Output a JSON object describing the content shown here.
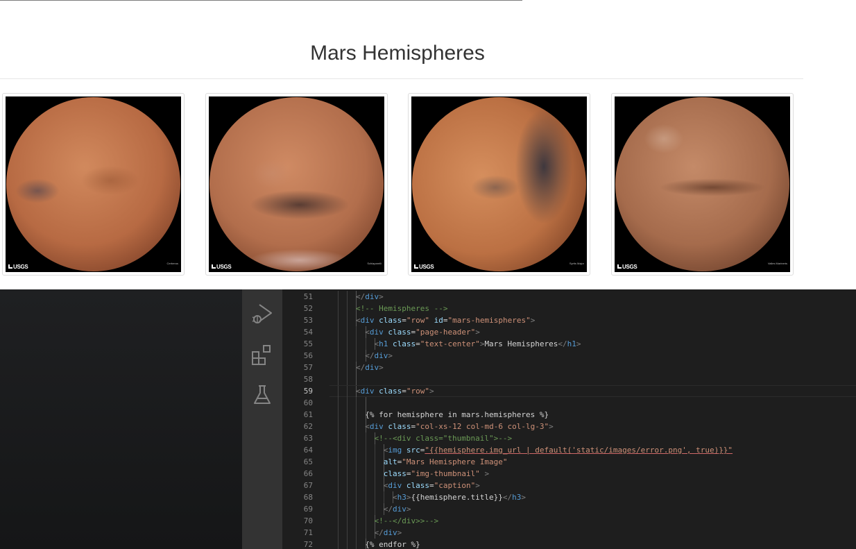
{
  "page": {
    "title": "Mars Hemispheres"
  },
  "hemispheres": [
    {
      "label": "Cerberus",
      "logo": "USGS"
    },
    {
      "label": "Schiaparelli",
      "logo": "USGS"
    },
    {
      "label": "Syrtis Major",
      "logo": "USGS"
    },
    {
      "label": "Valles Marineris",
      "logo": "USGS"
    }
  ],
  "activity_bar": {
    "items": [
      {
        "icon": "run-debug-icon"
      },
      {
        "icon": "extensions-icon"
      },
      {
        "icon": "testing-flask-icon"
      }
    ]
  },
  "editor": {
    "current_line": 59,
    "lines": [
      {
        "num": "51",
        "tokens": [
          {
            "t": "br",
            "v": "</"
          },
          {
            "t": "tag",
            "v": "div"
          },
          {
            "t": "br",
            "v": ">"
          }
        ],
        "indent": 3
      },
      {
        "num": "52",
        "tokens": [
          {
            "t": "cm",
            "v": "<!-- Hemispheres -->"
          }
        ],
        "indent": 3
      },
      {
        "num": "53",
        "tokens": [
          {
            "t": "br",
            "v": "<"
          },
          {
            "t": "tag",
            "v": "div"
          },
          {
            "t": "txt",
            "v": " "
          },
          {
            "t": "attr",
            "v": "class"
          },
          {
            "t": "txt",
            "v": "="
          },
          {
            "t": "str",
            "v": "\"row\""
          },
          {
            "t": "txt",
            "v": " "
          },
          {
            "t": "attr",
            "v": "id"
          },
          {
            "t": "txt",
            "v": "="
          },
          {
            "t": "str",
            "v": "\"mars-hemispheres\""
          },
          {
            "t": "br",
            "v": ">"
          }
        ],
        "indent": 3
      },
      {
        "num": "54",
        "tokens": [
          {
            "t": "br",
            "v": "<"
          },
          {
            "t": "tag",
            "v": "div"
          },
          {
            "t": "txt",
            "v": " "
          },
          {
            "t": "attr",
            "v": "class"
          },
          {
            "t": "txt",
            "v": "="
          },
          {
            "t": "str",
            "v": "\"page-header\""
          },
          {
            "t": "br",
            "v": ">"
          }
        ],
        "indent": 4
      },
      {
        "num": "55",
        "tokens": [
          {
            "t": "br",
            "v": "<"
          },
          {
            "t": "tag",
            "v": "h1"
          },
          {
            "t": "txt",
            "v": " "
          },
          {
            "t": "attr",
            "v": "class"
          },
          {
            "t": "txt",
            "v": "="
          },
          {
            "t": "str",
            "v": "\"text-center\""
          },
          {
            "t": "br",
            "v": ">"
          },
          {
            "t": "txt",
            "v": "Mars Hemispheres"
          },
          {
            "t": "br",
            "v": "</"
          },
          {
            "t": "tag",
            "v": "h1"
          },
          {
            "t": "br",
            "v": ">"
          }
        ],
        "indent": 5
      },
      {
        "num": "56",
        "tokens": [
          {
            "t": "br",
            "v": "</"
          },
          {
            "t": "tag",
            "v": "div"
          },
          {
            "t": "br",
            "v": ">"
          }
        ],
        "indent": 4
      },
      {
        "num": "57",
        "tokens": [
          {
            "t": "br",
            "v": "</"
          },
          {
            "t": "tag",
            "v": "div"
          },
          {
            "t": "br",
            "v": ">"
          }
        ],
        "indent": 3
      },
      {
        "num": "58",
        "tokens": [],
        "indent": 3
      },
      {
        "num": "59",
        "tokens": [
          {
            "t": "br",
            "v": "<"
          },
          {
            "t": "tag",
            "v": "div"
          },
          {
            "t": "txt",
            "v": " "
          },
          {
            "t": "attr",
            "v": "class"
          },
          {
            "t": "txt",
            "v": "="
          },
          {
            "t": "str",
            "v": "\"row\""
          },
          {
            "t": "br",
            "v": ">"
          }
        ],
        "indent": 3
      },
      {
        "num": "60",
        "tokens": [],
        "indent": 4
      },
      {
        "num": "61",
        "tokens": [
          {
            "t": "txt",
            "v": "{% for hemisphere in mars.hemispheres %}"
          }
        ],
        "indent": 4
      },
      {
        "num": "62",
        "tokens": [
          {
            "t": "br",
            "v": "<"
          },
          {
            "t": "tag",
            "v": "div"
          },
          {
            "t": "txt",
            "v": " "
          },
          {
            "t": "attr",
            "v": "class"
          },
          {
            "t": "txt",
            "v": "="
          },
          {
            "t": "str",
            "v": "\"col-xs-12 col-md-6 col-lg-3\""
          },
          {
            "t": "br",
            "v": ">"
          }
        ],
        "indent": 4
      },
      {
        "num": "63",
        "tokens": [
          {
            "t": "cm",
            "v": "<!--<div class=\"thumbnail\">-->"
          }
        ],
        "indent": 5
      },
      {
        "num": "64",
        "tokens": [
          {
            "t": "br",
            "v": "<"
          },
          {
            "t": "tag",
            "v": "img"
          },
          {
            "t": "txt",
            "v": " "
          },
          {
            "t": "attr",
            "v": "src"
          },
          {
            "t": "txt",
            "v": "="
          },
          {
            "t": "strul",
            "v": "\"{{hemisphere.img_url | default('static/images/error.png', true)}}\""
          }
        ],
        "indent": 6
      },
      {
        "num": "65",
        "tokens": [
          {
            "t": "attr",
            "v": "alt"
          },
          {
            "t": "txt",
            "v": "="
          },
          {
            "t": "str",
            "v": "\"Mars Hemisphere Image\""
          }
        ],
        "indent": 6
      },
      {
        "num": "66",
        "tokens": [
          {
            "t": "attr",
            "v": "class"
          },
          {
            "t": "txt",
            "v": "="
          },
          {
            "t": "str",
            "v": "\"img-thumbnail\""
          },
          {
            "t": "txt",
            "v": " "
          },
          {
            "t": "br",
            "v": ">"
          }
        ],
        "indent": 6
      },
      {
        "num": "67",
        "tokens": [
          {
            "t": "br",
            "v": "<"
          },
          {
            "t": "tag",
            "v": "div"
          },
          {
            "t": "txt",
            "v": " "
          },
          {
            "t": "attr",
            "v": "class"
          },
          {
            "t": "txt",
            "v": "="
          },
          {
            "t": "str",
            "v": "\"caption\""
          },
          {
            "t": "br",
            "v": ">"
          }
        ],
        "indent": 6
      },
      {
        "num": "68",
        "tokens": [
          {
            "t": "br",
            "v": "<"
          },
          {
            "t": "tag",
            "v": "h3"
          },
          {
            "t": "br",
            "v": ">"
          },
          {
            "t": "txt",
            "v": "{{hemisphere.title}}"
          },
          {
            "t": "br",
            "v": "</"
          },
          {
            "t": "tag",
            "v": "h3"
          },
          {
            "t": "br",
            "v": ">"
          }
        ],
        "indent": 7
      },
      {
        "num": "69",
        "tokens": [
          {
            "t": "br",
            "v": "</"
          },
          {
            "t": "tag",
            "v": "div"
          },
          {
            "t": "br",
            "v": ">"
          }
        ],
        "indent": 6
      },
      {
        "num": "70",
        "tokens": [
          {
            "t": "cm",
            "v": "<!--</div>>-->"
          }
        ],
        "indent": 5
      },
      {
        "num": "71",
        "tokens": [
          {
            "t": "br",
            "v": "</"
          },
          {
            "t": "tag",
            "v": "div"
          },
          {
            "t": "br",
            "v": ">"
          }
        ],
        "indent": 5
      },
      {
        "num": "72",
        "tokens": [
          {
            "t": "txt",
            "v": "{% endfor %}"
          }
        ],
        "indent": 4
      }
    ]
  },
  "colors": {
    "editor_bg": "#1e1e1e",
    "activity_bar_bg": "#333333",
    "tag": "#569cd6",
    "attribute": "#9cdcfe",
    "string": "#ce9178",
    "comment": "#6a9955"
  }
}
